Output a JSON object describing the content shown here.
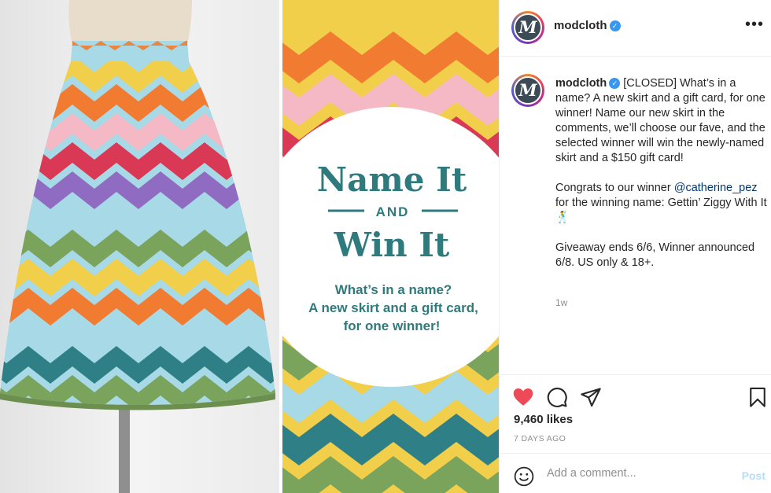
{
  "post": {
    "username": "modcloth",
    "verified_mark": "✓",
    "avatar_letter": "M",
    "more_icon": "•••",
    "graphic": {
      "title_line1": "Name It",
      "and": "AND",
      "title_line2": "Win It",
      "sub1": "What’s in a name?",
      "sub2": "A new skirt and a gift card,",
      "sub3": "for one winner!"
    },
    "caption": {
      "text1": "[CLOSED] What’s in a name? A new skirt and a gift card, for one winner! Name our new skirt in the comments, we’ll choose our fave, and the selected winner will win the newly-named skirt and a $150 gift card!",
      "text2_before": "Congrats to our winner ",
      "mention": "@catherine_pez",
      "text2_after": " for the winning name: Gettin’ Ziggy With It 🕺",
      "text3": "Giveaway ends 6/6, Winner announced 6/8. US only & 18+."
    },
    "time_ago": "1w",
    "likes": "9,460 likes",
    "date": "7 DAYS AGO",
    "comment_placeholder": "Add a comment...",
    "post_button": "Post",
    "icons": [
      "heart-icon",
      "comment-icon",
      "share-icon",
      "bookmark-icon",
      "emoji-icon",
      "more-icon",
      "verified-icon"
    ],
    "colors": {
      "heart": "#ed4956",
      "link": "#00376b",
      "post_button": "#b2dffc",
      "verified": "#3897f0",
      "chevron_stripes": [
        "#f2cf4a",
        "#f07b31",
        "#f4b9c4",
        "#d93954",
        "#8f6bc1",
        "#a8d9e6",
        "#2f7f86",
        "#7aa35b"
      ]
    }
  }
}
